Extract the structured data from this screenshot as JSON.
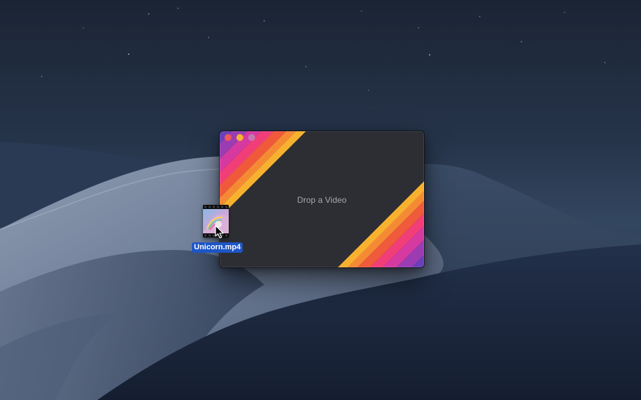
{
  "window": {
    "drop_prompt": "Drop a Video",
    "traffic_lights": {
      "close": "#ee5a5a",
      "minimize": "#f3b435",
      "zoom": "#c478b4"
    },
    "stripe_colors": [
      "#6a3fb9",
      "#d63aa0",
      "#f23e78",
      "#f05a3a",
      "#f68a34",
      "#f8b12f"
    ],
    "background": "#2d2e33"
  },
  "dragged_file": {
    "name": "Unicorn.mp4",
    "icon": "video-file-icon"
  },
  "cursor": {
    "icon": "arrow-cursor-icon"
  },
  "desktop": {
    "wallpaper": "mojave-dunes-night"
  }
}
